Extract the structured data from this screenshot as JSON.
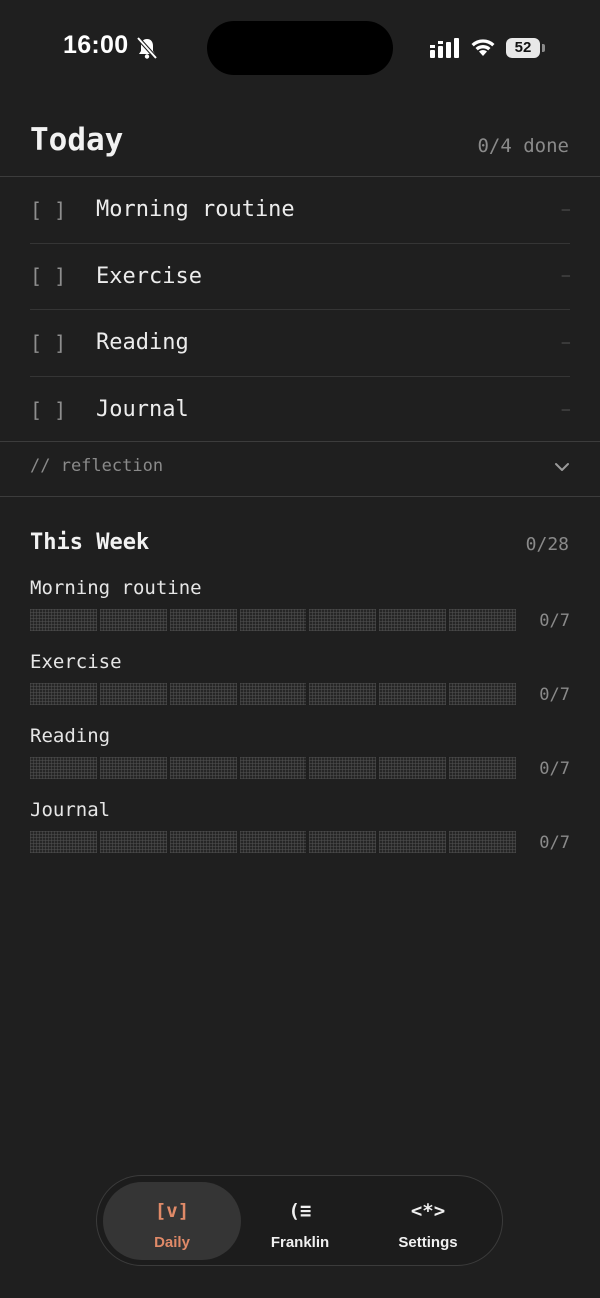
{
  "status_bar": {
    "time": "16:00",
    "battery": "52",
    "icons": [
      "bell-slash-icon",
      "signal-icon",
      "wifi-icon",
      "battery-icon"
    ]
  },
  "today": {
    "title": "Today",
    "count": "0/4 done",
    "habits": [
      {
        "checkbox": "[ ]",
        "name": "Morning routine",
        "value": "—"
      },
      {
        "checkbox": "[ ]",
        "name": "Exercise",
        "value": "—"
      },
      {
        "checkbox": "[ ]",
        "name": "Reading",
        "value": "—"
      },
      {
        "checkbox": "[ ]",
        "name": "Journal",
        "value": "—"
      }
    ]
  },
  "reflection": {
    "label": "// reflection",
    "icon": "chevron-down-icon"
  },
  "week": {
    "title": "This Week",
    "count": "0/28",
    "items": [
      {
        "name": "Morning routine",
        "fraction": "0/7",
        "done": 0,
        "total": 7
      },
      {
        "name": "Exercise",
        "fraction": "0/7",
        "done": 0,
        "total": 7
      },
      {
        "name": "Reading",
        "fraction": "0/7",
        "done": 0,
        "total": 7
      },
      {
        "name": "Journal",
        "fraction": "0/7",
        "done": 0,
        "total": 7
      }
    ]
  },
  "tabs": [
    {
      "glyph": "[v]",
      "label": "Daily",
      "active": true
    },
    {
      "glyph": "(≡",
      "label": "Franklin",
      "active": false
    },
    {
      "glyph": "<*>",
      "label": "Settings",
      "active": false
    }
  ],
  "colors": {
    "background": "#1f1f1f",
    "accent": "#e08a68",
    "text": "#ececec",
    "muted": "#8a8a8a"
  }
}
